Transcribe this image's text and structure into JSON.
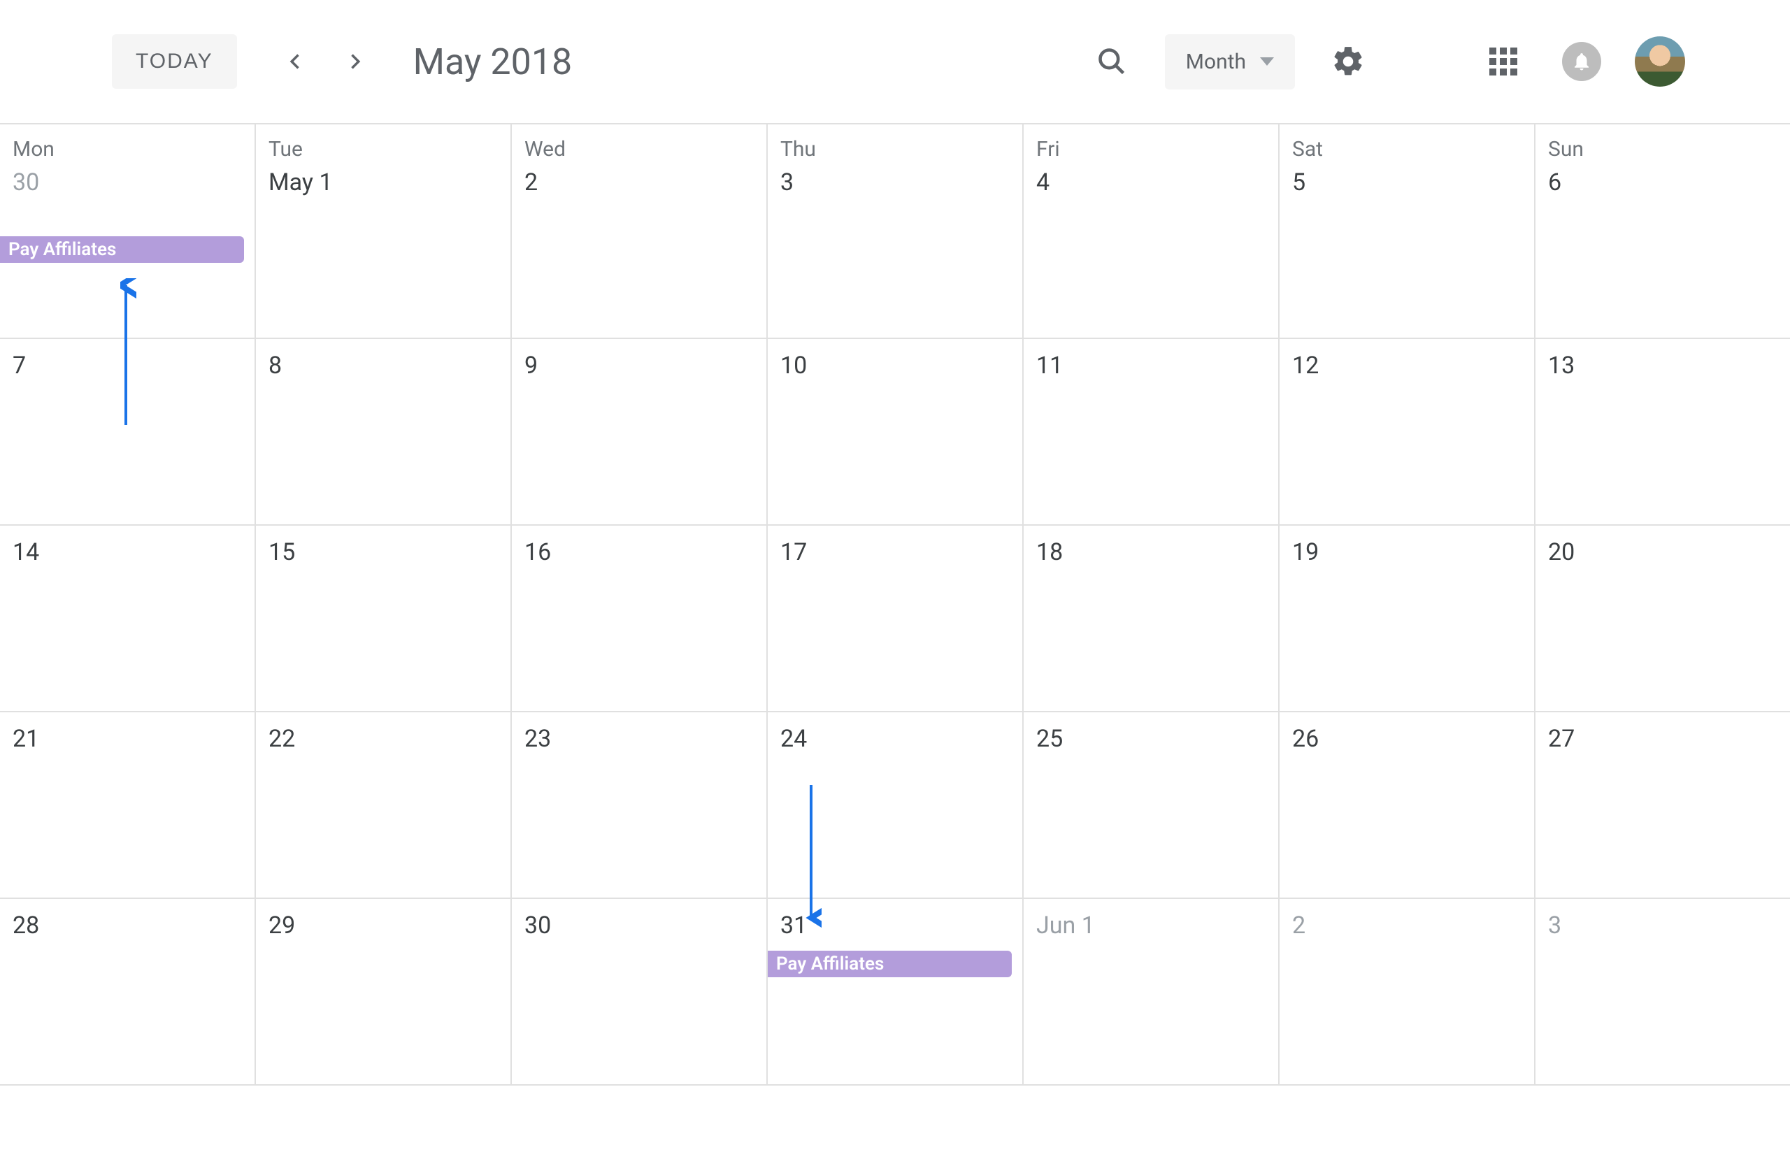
{
  "header": {
    "today_label": "TODAY",
    "month_title": "May 2018",
    "view_label": "Month"
  },
  "days_of_week": [
    "Mon",
    "Tue",
    "Wed",
    "Thu",
    "Fri",
    "Sat",
    "Sun"
  ],
  "weeks": [
    [
      {
        "label": "30",
        "muted": true
      },
      {
        "label": "May 1",
        "muted": false
      },
      {
        "label": "2",
        "muted": false
      },
      {
        "label": "3",
        "muted": false
      },
      {
        "label": "4",
        "muted": false
      },
      {
        "label": "5",
        "muted": false
      },
      {
        "label": "6",
        "muted": false
      }
    ],
    [
      {
        "label": "7",
        "muted": false
      },
      {
        "label": "8",
        "muted": false
      },
      {
        "label": "9",
        "muted": false
      },
      {
        "label": "10",
        "muted": false
      },
      {
        "label": "11",
        "muted": false
      },
      {
        "label": "12",
        "muted": false
      },
      {
        "label": "13",
        "muted": false
      }
    ],
    [
      {
        "label": "14",
        "muted": false
      },
      {
        "label": "15",
        "muted": false
      },
      {
        "label": "16",
        "muted": false
      },
      {
        "label": "17",
        "muted": false
      },
      {
        "label": "18",
        "muted": false
      },
      {
        "label": "19",
        "muted": false
      },
      {
        "label": "20",
        "muted": false
      }
    ],
    [
      {
        "label": "21",
        "muted": false
      },
      {
        "label": "22",
        "muted": false
      },
      {
        "label": "23",
        "muted": false
      },
      {
        "label": "24",
        "muted": false
      },
      {
        "label": "25",
        "muted": false
      },
      {
        "label": "26",
        "muted": false
      },
      {
        "label": "27",
        "muted": false
      }
    ],
    [
      {
        "label": "28",
        "muted": false
      },
      {
        "label": "29",
        "muted": false
      },
      {
        "label": "30",
        "muted": false
      },
      {
        "label": "31",
        "muted": false
      },
      {
        "label": "Jun 1",
        "muted": true
      },
      {
        "label": "2",
        "muted": true
      },
      {
        "label": "3",
        "muted": true
      }
    ]
  ],
  "events": {
    "first": "Pay Affiliates",
    "second": "Pay Affiliates"
  },
  "colors": {
    "event_bg": "#b39ddb",
    "annotation_arrow": "#1a73e8"
  }
}
